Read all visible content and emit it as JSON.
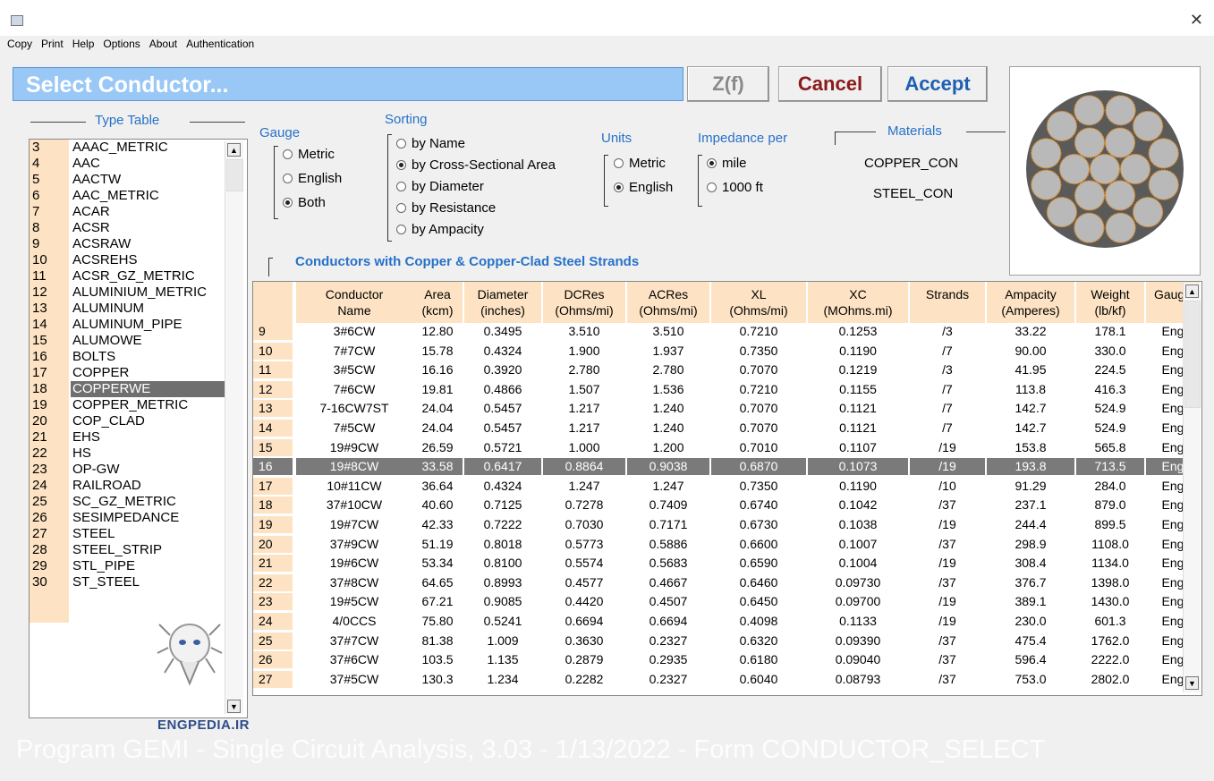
{
  "menu": [
    "Copy",
    "Print",
    "Help",
    "Options",
    "About",
    "Authentication"
  ],
  "close_glyph": "✕",
  "header": {
    "title": "Select Conductor..."
  },
  "buttons": {
    "zf": "Z(f)",
    "cancel": "Cancel",
    "accept": "Accept"
  },
  "type_table": {
    "title": "Type Table",
    "rows": [
      {
        "n": "3",
        "name": "AAAC_METRIC"
      },
      {
        "n": "4",
        "name": "AAC"
      },
      {
        "n": "5",
        "name": "AACTW"
      },
      {
        "n": "6",
        "name": "AAC_METRIC"
      },
      {
        "n": "7",
        "name": "ACAR"
      },
      {
        "n": "8",
        "name": "ACSR"
      },
      {
        "n": "9",
        "name": "ACSRAW"
      },
      {
        "n": "10",
        "name": "ACSREHS"
      },
      {
        "n": "11",
        "name": "ACSR_GZ_METRIC"
      },
      {
        "n": "12",
        "name": "ALUMINIUM_METRIC"
      },
      {
        "n": "13",
        "name": "ALUMINUM"
      },
      {
        "n": "14",
        "name": "ALUMINUM_PIPE"
      },
      {
        "n": "15",
        "name": "ALUMOWE"
      },
      {
        "n": "16",
        "name": "BOLTS"
      },
      {
        "n": "17",
        "name": "COPPER"
      },
      {
        "n": "18",
        "name": "COPPERWE"
      },
      {
        "n": "19",
        "name": "COPPER_METRIC"
      },
      {
        "n": "20",
        "name": "COP_CLAD"
      },
      {
        "n": "21",
        "name": "EHS"
      },
      {
        "n": "22",
        "name": "HS"
      },
      {
        "n": "23",
        "name": "OP-GW"
      },
      {
        "n": "24",
        "name": "RAILROAD"
      },
      {
        "n": "25",
        "name": "SC_GZ_METRIC"
      },
      {
        "n": "26",
        "name": "SESIMPEDANCE"
      },
      {
        "n": "27",
        "name": "STEEL"
      },
      {
        "n": "28",
        "name": "STEEL_STRIP"
      },
      {
        "n": "29",
        "name": "STL_PIPE"
      },
      {
        "n": "30",
        "name": "ST_STEEL"
      }
    ],
    "selected_index": 15
  },
  "gauge": {
    "title": "Gauge",
    "options": [
      "Metric",
      "English",
      "Both"
    ],
    "selected": 2
  },
  "sorting": {
    "title": "Sorting",
    "options": [
      "by Name",
      "by Cross-Sectional Area",
      "by Diameter",
      "by Resistance",
      "by Ampacity"
    ],
    "selected": 1
  },
  "units": {
    "title": "Units",
    "options": [
      "Metric",
      "English"
    ],
    "selected": 1
  },
  "impedance": {
    "title": "Impedance per",
    "options": [
      "mile",
      "1000 ft"
    ],
    "selected": 0
  },
  "materials": {
    "title": "Materials",
    "items": [
      "COPPER_CON",
      "STEEL_CON"
    ]
  },
  "table": {
    "title": "Conductors with Copper & Copper-Clad Steel Strands",
    "headers": [
      [
        "Conductor",
        "Name"
      ],
      [
        "Area",
        "(kcm)"
      ],
      [
        "Diameter",
        "(inches)"
      ],
      [
        "DCRes",
        "(Ohms/mi)"
      ],
      [
        "ACRes",
        "(Ohms/mi)"
      ],
      [
        "XL",
        "(Ohms/mi)"
      ],
      [
        "XC",
        "(MOhms.mi)"
      ],
      [
        "Strands",
        ""
      ],
      [
        "Ampacity",
        "(Amperes)"
      ],
      [
        "Weight",
        "(lb/kf)"
      ],
      [
        "Gauge",
        ""
      ]
    ],
    "rows": [
      [
        "9",
        "3#6CW",
        "12.80",
        "0.3495",
        "3.510",
        "3.510",
        "0.7210",
        "0.1253",
        "/3",
        "33.22",
        "178.1",
        "Eng"
      ],
      [
        "10",
        "7#7CW",
        "15.78",
        "0.4324",
        "1.900",
        "1.937",
        "0.7350",
        "0.1190",
        "/7",
        "90.00",
        "330.0",
        "Eng"
      ],
      [
        "11",
        "3#5CW",
        "16.16",
        "0.3920",
        "2.780",
        "2.780",
        "0.7070",
        "0.1219",
        "/3",
        "41.95",
        "224.5",
        "Eng"
      ],
      [
        "12",
        "7#6CW",
        "19.81",
        "0.4866",
        "1.507",
        "1.536",
        "0.7210",
        "0.1155",
        "/7",
        "113.8",
        "416.3",
        "Eng"
      ],
      [
        "13",
        "7-16CW7ST",
        "24.04",
        "0.5457",
        "1.217",
        "1.240",
        "0.7070",
        "0.1121",
        "/7",
        "142.7",
        "524.9",
        "Eng"
      ],
      [
        "14",
        "7#5CW",
        "24.04",
        "0.5457",
        "1.217",
        "1.240",
        "0.7070",
        "0.1121",
        "/7",
        "142.7",
        "524.9",
        "Eng"
      ],
      [
        "15",
        "19#9CW",
        "26.59",
        "0.5721",
        "1.000",
        "1.200",
        "0.7010",
        "0.1107",
        "/19",
        "153.8",
        "565.8",
        "Eng"
      ],
      [
        "16",
        "19#8CW",
        "33.58",
        "0.6417",
        "0.8864",
        "0.9038",
        "0.6870",
        "0.1073",
        "/19",
        "193.8",
        "713.5",
        "Eng"
      ],
      [
        "17",
        "10#11CW",
        "36.64",
        "0.4324",
        "1.247",
        "1.247",
        "0.7350",
        "0.1190",
        "/10",
        "91.29",
        "284.0",
        "Eng"
      ],
      [
        "18",
        "37#10CW",
        "40.60",
        "0.7125",
        "0.7278",
        "0.7409",
        "0.6740",
        "0.1042",
        "/37",
        "237.1",
        "879.0",
        "Eng"
      ],
      [
        "19",
        "19#7CW",
        "42.33",
        "0.7222",
        "0.7030",
        "0.7171",
        "0.6730",
        "0.1038",
        "/19",
        "244.4",
        "899.5",
        "Eng"
      ],
      [
        "20",
        "37#9CW",
        "51.19",
        "0.8018",
        "0.5773",
        "0.5886",
        "0.6600",
        "0.1007",
        "/37",
        "298.9",
        "1108.0",
        "Eng"
      ],
      [
        "21",
        "19#6CW",
        "53.34",
        "0.8100",
        "0.5574",
        "0.5683",
        "0.6590",
        "0.1004",
        "/19",
        "308.4",
        "1134.0",
        "Eng"
      ],
      [
        "22",
        "37#8CW",
        "64.65",
        "0.8993",
        "0.4577",
        "0.4667",
        "0.6460",
        "0.09730",
        "/37",
        "376.7",
        "1398.0",
        "Eng"
      ],
      [
        "23",
        "19#5CW",
        "67.21",
        "0.9085",
        "0.4420",
        "0.4507",
        "0.6450",
        "0.09700",
        "/19",
        "389.1",
        "1430.0",
        "Eng"
      ],
      [
        "24",
        "4/0CCS",
        "75.80",
        "0.5241",
        "0.6694",
        "0.6694",
        "0.4098",
        "0.1133",
        "/19",
        "230.0",
        "601.3",
        "Eng"
      ],
      [
        "25",
        "37#7CW",
        "81.38",
        "1.009",
        "0.3630",
        "0.2327",
        "0.6320",
        "0.09390",
        "/37",
        "475.4",
        "1762.0",
        "Eng"
      ],
      [
        "26",
        "37#6CW",
        "103.5",
        "1.135",
        "0.2879",
        "0.2935",
        "0.6180",
        "0.09040",
        "/37",
        "596.4",
        "2222.0",
        "Eng"
      ],
      [
        "27",
        "37#5CW",
        "130.3",
        "1.234",
        "0.2282",
        "0.2327",
        "0.6040",
        "0.08793",
        "/37",
        "753.0",
        "2802.0",
        "Eng"
      ]
    ],
    "selected_index": 7
  },
  "watermark": {
    "text": "ENGPEDIA.IR"
  },
  "footer": {
    "text": "Program GEMI - Single Circuit Analysis, 3.03 - 1/13/2022 - Form CONDUCTOR_SELECT"
  },
  "colors": {
    "header_bg": "#99c8f7",
    "accent_blue": "#2671c9",
    "cancel": "#8b1a1a",
    "accept": "#1c5fb3",
    "row_num_bg": "#fde3c3",
    "selection": "#7a7a7a",
    "strand": "#b9b9b9",
    "strand_outline": "#e58f1f"
  }
}
